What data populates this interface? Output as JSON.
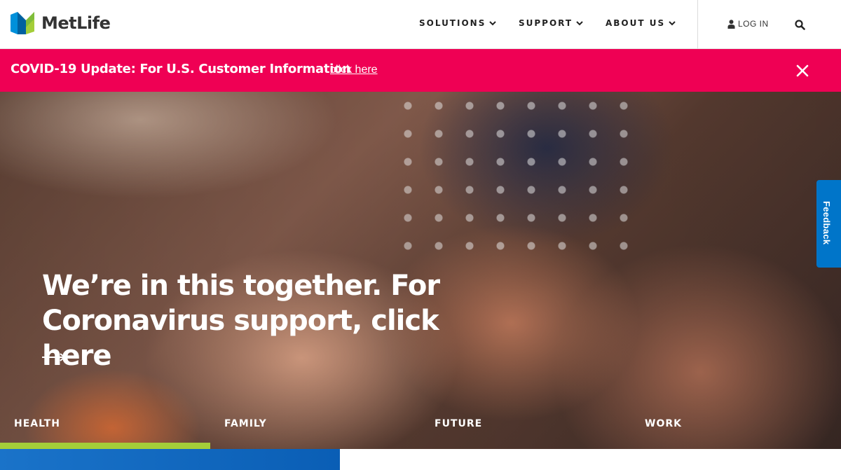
{
  "header": {
    "brand": "MetLife",
    "nav": [
      {
        "label": "SOLUTIONS"
      },
      {
        "label": "SUPPORT"
      },
      {
        "label": "ABOUT US"
      }
    ],
    "login_label": "LOG IN"
  },
  "alert": {
    "text": "COVID-19 Update: For U.S. Customer Information",
    "link": "click here"
  },
  "hero": {
    "title": "We’re in this together. For Coronavirus support, click here",
    "tabs": [
      {
        "label": "HEALTH",
        "active": true
      },
      {
        "label": "FAMILY",
        "active": false
      },
      {
        "label": "FUTURE",
        "active": false
      },
      {
        "label": "WORK",
        "active": false
      }
    ]
  },
  "feedback": {
    "label": "Feedback"
  },
  "colors": {
    "alert_bg": "#ef0054",
    "active_tab_bar": "#a4ce39",
    "feedback_bg": "#0075c9",
    "logo_blue": "#0090da",
    "logo_green": "#a4ce39"
  },
  "icons": [
    "metlife-logo-icon",
    "chevron-down-icon",
    "user-icon",
    "search-icon",
    "close-icon",
    "arrow-right-icon"
  ]
}
